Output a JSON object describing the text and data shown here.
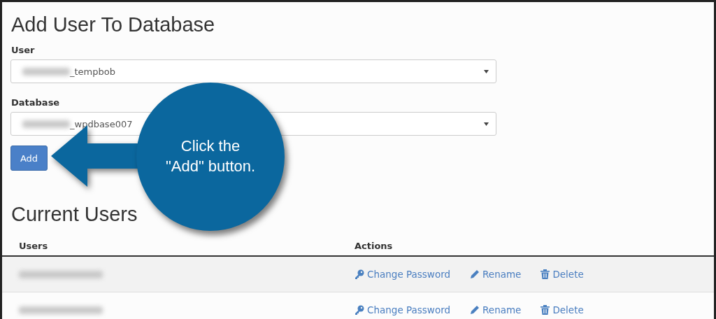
{
  "add_user_section": {
    "title": "Add User To Database",
    "fields": [
      {
        "label": "User",
        "value": "_tempbob"
      },
      {
        "label": "Database",
        "value": "_wpdbase007"
      }
    ],
    "button": "Add"
  },
  "callout": {
    "lines": [
      "Click the",
      "\"Add\" button."
    ]
  },
  "current_users": {
    "title": "Current Users",
    "columns": [
      "Users",
      "Actions"
    ],
    "rows": [
      {
        "actions": [
          {
            "kind": "key",
            "label": "Change Password"
          },
          {
            "kind": "pencil",
            "label": "Rename"
          },
          {
            "kind": "trash",
            "label": "Delete"
          }
        ]
      },
      {
        "actions": [
          {
            "kind": "key",
            "label": "Change Password"
          },
          {
            "kind": "pencil",
            "label": "Rename"
          },
          {
            "kind": "trash",
            "label": "Delete"
          }
        ]
      }
    ]
  }
}
